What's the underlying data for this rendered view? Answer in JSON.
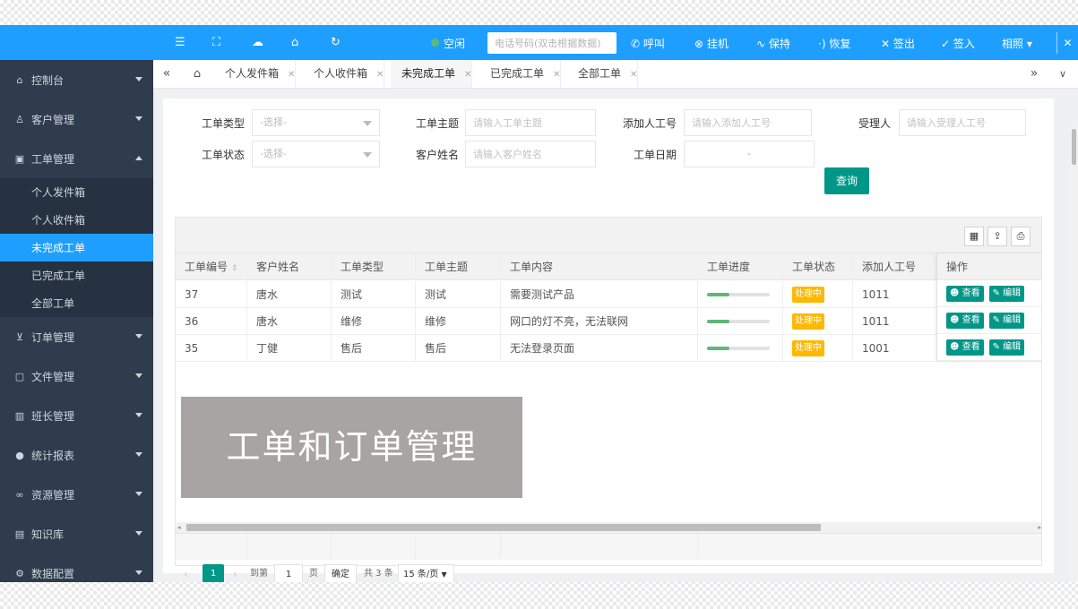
{
  "sidebar": {
    "items": [
      {
        "label": "控制台",
        "icon": "home-icon",
        "glyph": "⌂"
      },
      {
        "label": "客户管理",
        "icon": "user-icon",
        "glyph": "♙"
      },
      {
        "label": "工单管理",
        "icon": "workorder-icon",
        "glyph": "▣",
        "expanded": true
      }
    ],
    "sub_items": [
      "个人发件箱",
      "个人收件箱",
      "未完成工单",
      "已完成工单",
      "全部工单"
    ],
    "items2": [
      {
        "label": "订单管理",
        "icon": "cart-icon",
        "glyph": "⊻"
      },
      {
        "label": "文件管理",
        "icon": "file-icon",
        "glyph": "▢"
      },
      {
        "label": "班长管理",
        "icon": "chart-icon",
        "glyph": "▥"
      },
      {
        "label": "统计报表",
        "icon": "chat-icon",
        "glyph": "●"
      },
      {
        "label": "资源管理",
        "icon": "link-icon",
        "glyph": "∞"
      },
      {
        "label": "知识库",
        "icon": "book-icon",
        "glyph": "▤"
      },
      {
        "label": "数据配置",
        "icon": "gear-icon",
        "glyph": "⚙"
      }
    ]
  },
  "topbar": {
    "status": "空闲",
    "phone_placeholder": "电话号码(双击根据数据)",
    "buttons": [
      "呼叫",
      "挂机",
      "保持",
      "恢复",
      "签出",
      "签入",
      "相照"
    ],
    "accent": "#1e9fff"
  },
  "tabs": [
    "个人发件箱",
    "个人收件箱",
    "未完成工单",
    "已完成工单",
    "全部工单"
  ],
  "search": {
    "type_label": "工单类型",
    "type_placeholder": "-选择-",
    "subject_label": "工单主题",
    "subject_placeholder": "请输入工单主题",
    "adder_label": "添加人工号",
    "adder_placeholder": "请输入添加人工号",
    "acceptor_label": "受理人",
    "acceptor_placeholder": "请输入受理人工号",
    "status_label": "工单状态",
    "status_placeholder": "-选择-",
    "customer_label": "客户姓名",
    "customer_placeholder": "请输入客户姓名",
    "date_label": "工单日期",
    "date_value": "-",
    "query_label": "查询"
  },
  "table": {
    "headers": [
      "工单编号",
      "客户姓名",
      "工单类型",
      "工单主题",
      "工单内容",
      "工单进度",
      "工单状态",
      "添加人工号",
      "操作"
    ],
    "rows": [
      {
        "id": "37",
        "customer": "唐水",
        "type": "测试",
        "subject": "测试",
        "content": "需要测试产品",
        "progress": 0.35,
        "status": "处理中",
        "adder": "1011",
        "extra": "1"
      },
      {
        "id": "36",
        "customer": "唐水",
        "type": "维修",
        "subject": "维修",
        "content": "网口的灯不亮，无法联网",
        "progress": 0.35,
        "status": "处理中",
        "adder": "1011",
        "extra": "1"
      },
      {
        "id": "35",
        "customer": "丁健",
        "type": "售后",
        "subject": "售后",
        "content": "无法登录页面",
        "progress": 0.35,
        "status": "处理中",
        "adder": "1001",
        "extra": "1"
      }
    ],
    "view_label": "查看",
    "edit_label": "编辑"
  },
  "banner": "工单和订单管理",
  "pager": {
    "current": "1",
    "goto_label": "到第",
    "page_input": "1",
    "page_unit": "页",
    "confirm": "确定",
    "total": "共 3 条",
    "per_page": "15 条/页"
  }
}
